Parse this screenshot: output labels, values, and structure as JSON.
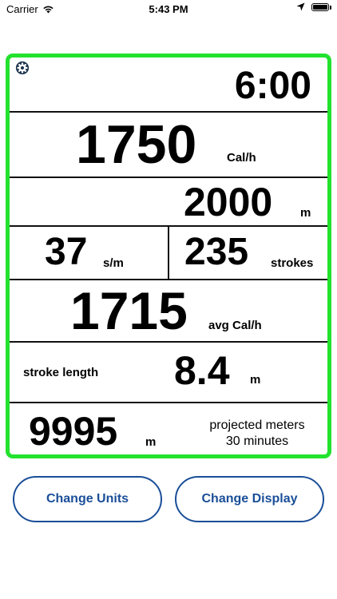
{
  "status_bar": {
    "carrier": "Carrier",
    "time": "5:43 PM"
  },
  "panel": {
    "time": "6:00",
    "calories_per_hour": {
      "value": "1750",
      "unit": "Cal/h"
    },
    "distance": {
      "value": "2000",
      "unit": "m"
    },
    "stroke_rate": {
      "value": "37",
      "unit": "s/m"
    },
    "strokes": {
      "value": "235",
      "unit": "strokes"
    },
    "avg_calories": {
      "value": "1715",
      "unit": "avg Cal/h"
    },
    "stroke_length": {
      "label": "stroke length",
      "value": "8.4",
      "unit": "m"
    },
    "projected": {
      "value": "9995",
      "unit": "m",
      "label_line1": "projected meters",
      "label_line2": "30 minutes"
    }
  },
  "buttons": {
    "change_units": "Change Units",
    "change_display": "Change Display"
  },
  "colors": {
    "panel_border": "#22e22e",
    "button_accent": "#1a4e98"
  },
  "icons": [
    "wifi-icon",
    "location-arrow-icon",
    "battery-icon",
    "gear-icon"
  ]
}
